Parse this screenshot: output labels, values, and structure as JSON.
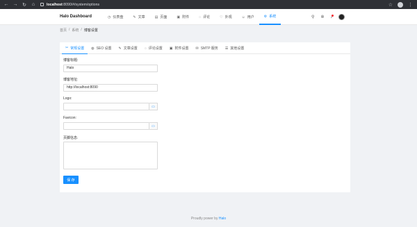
{
  "browser": {
    "address_host": "localhost",
    "address_path": ":8090/#/system/options"
  },
  "app": {
    "brand": "Halo Dashboard",
    "menu": [
      {
        "label": "仪表盘",
        "icon": "dashboard-icon"
      },
      {
        "label": "文章",
        "icon": "edit-icon"
      },
      {
        "label": "页面",
        "icon": "page-icon"
      },
      {
        "label": "附件",
        "icon": "picture-icon"
      },
      {
        "label": "评论",
        "icon": "comment-icon"
      },
      {
        "label": "外观",
        "icon": "skin-icon"
      },
      {
        "label": "用户",
        "icon": "user-icon"
      },
      {
        "label": "系统",
        "icon": "setting-icon"
      }
    ],
    "active_menu": "系统"
  },
  "breadcrumb": [
    "首页",
    "系统",
    "博客设置"
  ],
  "tabs": [
    {
      "label": "常规设置",
      "icon": "tool-icon"
    },
    {
      "label": "SEO 设置",
      "icon": "global-icon"
    },
    {
      "label": "文章设置",
      "icon": "edit-icon"
    },
    {
      "label": "评论设置",
      "icon": "message-icon"
    },
    {
      "label": "附件设置",
      "icon": "picture-icon"
    },
    {
      "label": "SMTP 服务",
      "icon": "mail-icon"
    },
    {
      "label": "其他设置",
      "icon": "other-icon"
    }
  ],
  "form": {
    "blog_title_label": "博客标题:",
    "blog_title_value": "Halo",
    "blog_url_label": "博客地址:",
    "blog_url_value": "http://localhost:8090",
    "logo_label": "Logo:",
    "logo_value": "",
    "favicon_label": "Favicon:",
    "favicon_value": "",
    "footer_label": "页脚信息:",
    "footer_value": "",
    "save_label": "保 存"
  },
  "footer": {
    "prefix": "Proudly power by ",
    "link": "Halo"
  },
  "colors": {
    "accent": "#1890ff",
    "background": "#f0f2f5",
    "chrome": "#2f3136"
  }
}
